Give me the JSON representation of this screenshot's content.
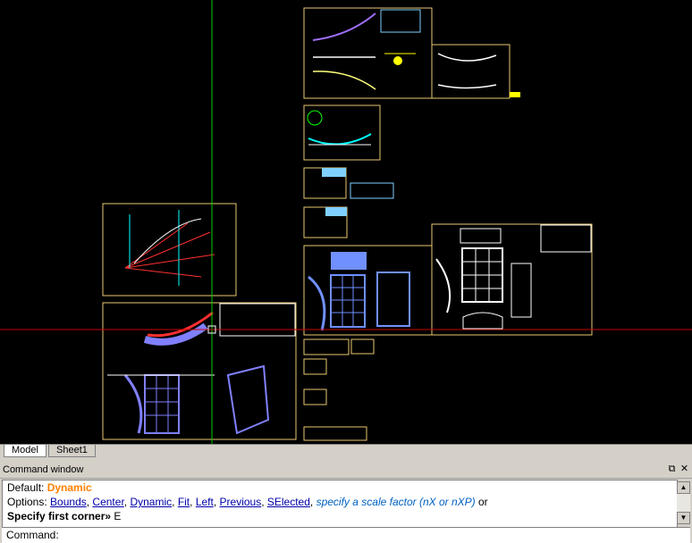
{
  "tabs": [
    {
      "label": "Model",
      "active": true
    },
    {
      "label": "Sheet1",
      "active": false
    }
  ],
  "command_window": {
    "title": "Command window",
    "restore_icon": "restore-window-icon",
    "close_icon": "close-icon",
    "history": {
      "line1_prefix": "Default:",
      "line1_value": "Dynamic",
      "line2_prefix": "Options:",
      "options": [
        "Bounds",
        "Center",
        "Dynamic",
        "Fit",
        "Left",
        "Previous",
        "SElected"
      ],
      "line2_hint": "specify a scale factor (nX or nXP)",
      "line2_suffix": "or",
      "line3_prompt": "Specify first corner»",
      "line3_value": "E"
    },
    "prompt_label": "Command:",
    "input_value": ""
  },
  "colors": {
    "canvas_bg": "#000000",
    "crosshair_vertical": "#00cc00",
    "crosshair_horizontal": "#cc0000",
    "sheet_border": "#e8c870",
    "accent": "#ff8000"
  }
}
